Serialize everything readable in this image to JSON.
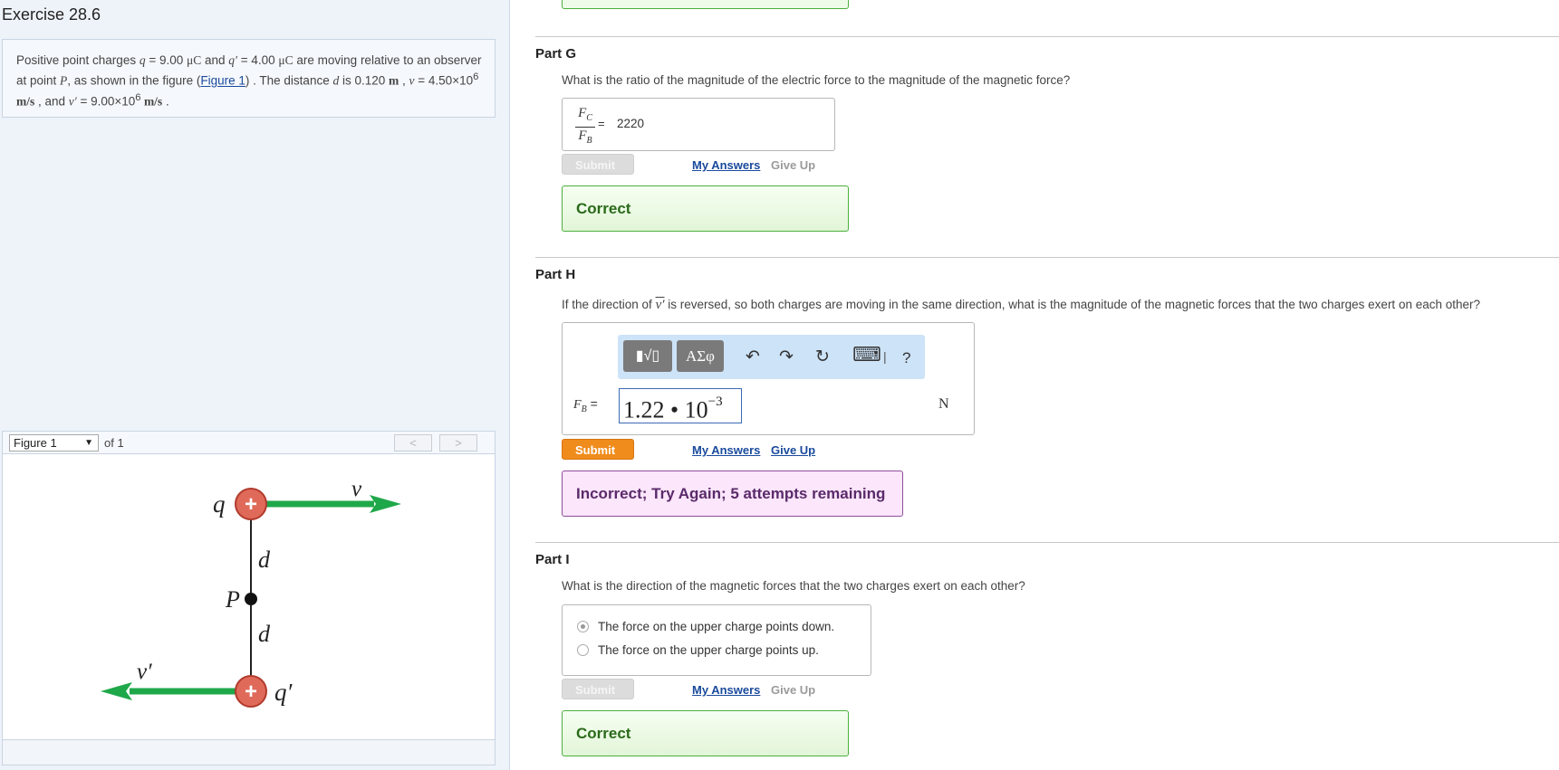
{
  "exercise": {
    "title": "Exercise 28.6"
  },
  "problem": {
    "t1": "Positive point charges ",
    "q_sym": "q",
    "t2": " = 9.00 ",
    "unit_uc": "μC",
    "t3": " and ",
    "qp_sym": "q′",
    "t4": " = 4.00 ",
    "t5": " are moving relative to an observer at point ",
    "p_sym": "P",
    "t6": ", as shown in the figure (",
    "figure_link": "Figure 1",
    "t7": ") . The distance ",
    "d_sym": "d",
    "t8": " is 0.120 ",
    "m_unit": "m",
    "t9": " , ",
    "v_sym": "v",
    "t10": " = 4.50×10",
    "exp6": "6",
    "ms_unit": " m/s",
    "t11": " , and ",
    "vp_sym": "v′",
    "t12": " = 9.00×10",
    "t13": " ."
  },
  "figure_nav": {
    "selected": "Figure 1",
    "of_label": "of 1",
    "prev": "<",
    "next": ">"
  },
  "figure": {
    "q_label": "q",
    "qp_label": "q′",
    "v_label": "v",
    "vp_label": "v′",
    "p_label": "P",
    "d_label": "d",
    "plus": "+",
    "colors": {
      "arrow": "#1fa84a",
      "charge": "#e06a5a",
      "charge_stroke": "#c0392b"
    }
  },
  "partG": {
    "title": "Part G",
    "question": "What is the ratio of the magnitude of the electric force to the magnitude of the magnetic force?",
    "fc": "F",
    "fc_sub": "C",
    "fb": "F",
    "fb_sub": "B",
    "eq": "=",
    "answer": "2220",
    "submit": "Submit",
    "my_answers": "My Answers",
    "give_up": "Give Up",
    "feedback": "Correct"
  },
  "partH": {
    "title": "Part H",
    "q1": "If the direction of ",
    "vp_sym": "v′",
    "q2": " is reversed, so both charges are moving in the same direction, what is the magnitude of the magnetic forces that the two charges exert on each other?",
    "toolbar": {
      "templates_icon": "▮√▯",
      "greek": "ΑΣφ",
      "undo_icon": "↶",
      "redo_icon": "↷",
      "reset_icon": "↻",
      "keyboard_icon": "⌨",
      "separator": "|",
      "help": "?"
    },
    "label_f": "F",
    "label_sub": "B",
    "label_eq": "=",
    "answer_mantissa": "1.22 • 10",
    "answer_exp": "−3",
    "unit": "N",
    "submit": "Submit",
    "my_answers": "My Answers",
    "give_up": "Give Up",
    "feedback": "Incorrect; Try Again; 5 attempts remaining"
  },
  "partI": {
    "title": "Part I",
    "question": "What is the direction of the magnetic forces that the two charges exert on each other?",
    "options": [
      {
        "label": "The force on the upper charge points down.",
        "selected": true
      },
      {
        "label": "The force on the upper charge points up.",
        "selected": false
      }
    ],
    "submit": "Submit",
    "my_answers": "My Answers",
    "give_up": "Give Up",
    "feedback": "Correct"
  }
}
